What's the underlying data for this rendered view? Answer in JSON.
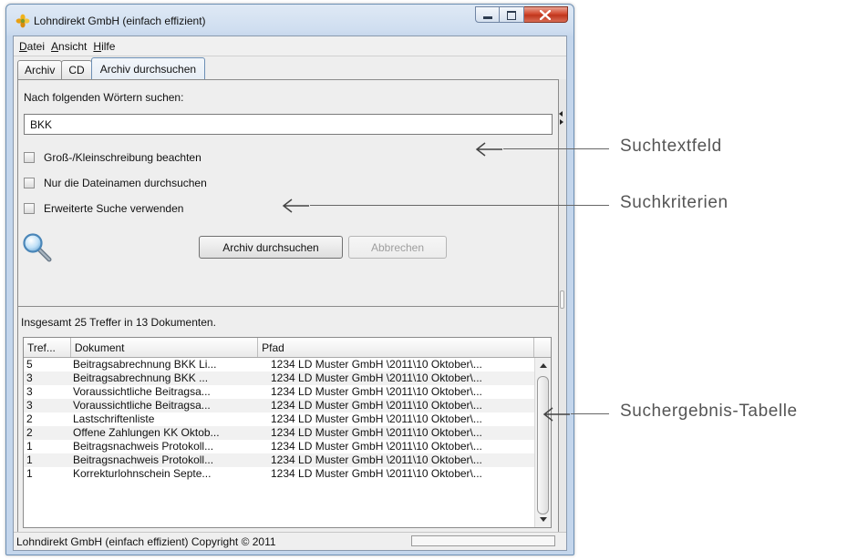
{
  "window": {
    "title": "Lohndirekt GmbH (einfach effizient)"
  },
  "menu": [
    {
      "mnemonic": "D",
      "rest": "atei"
    },
    {
      "mnemonic": "A",
      "rest": "nsicht"
    },
    {
      "mnemonic": "H",
      "rest": "ilfe"
    }
  ],
  "tabs": [
    {
      "label": "Archiv",
      "active": false
    },
    {
      "label": "CD",
      "active": false
    },
    {
      "label": "Archiv durchsuchen",
      "active": true
    }
  ],
  "search": {
    "label": "Nach folgenden Wörtern suchen:",
    "value": "BKK",
    "options": [
      {
        "label": "Groß-/Kleinschreibung beachten",
        "checked": false
      },
      {
        "label": "Nur die Dateinamen durchsuchen",
        "checked": false
      },
      {
        "label": "Erweiterte Suche verwenden",
        "checked": false
      }
    ],
    "search_button": "Archiv durchsuchen",
    "cancel_button": "Abbrechen"
  },
  "results": {
    "summary": "Insgesamt 25 Treffer in 13 Dokumenten.",
    "columns": [
      "Tref...",
      "Dokument",
      "Pfad"
    ],
    "rows": [
      {
        "hits": "5",
        "document": "Beitragsabrechnung BKK Li...",
        "path": "1234 LD Muster GmbH \\2011\\10 Oktober\\..."
      },
      {
        "hits": "3",
        "document": "Beitragsabrechnung BKK ...",
        "path": "1234 LD Muster GmbH \\2011\\10 Oktober\\..."
      },
      {
        "hits": "3",
        "document": "Voraussichtliche Beitragsa...",
        "path": "1234 LD Muster GmbH \\2011\\10 Oktober\\..."
      },
      {
        "hits": "3",
        "document": "Voraussichtliche Beitragsa...",
        "path": "1234 LD Muster GmbH \\2011\\10 Oktober\\..."
      },
      {
        "hits": "2",
        "document": "Lastschriftenliste",
        "path": "1234 LD Muster GmbH \\2011\\10 Oktober\\..."
      },
      {
        "hits": "2",
        "document": "Offene Zahlungen KK Oktob...",
        "path": "1234 LD Muster GmbH \\2011\\10 Oktober\\..."
      },
      {
        "hits": "1",
        "document": "Beitragsnachweis Protokoll...",
        "path": "1234 LD Muster GmbH \\2011\\10 Oktober\\..."
      },
      {
        "hits": "1",
        "document": "Beitragsnachweis Protokoll...",
        "path": "1234 LD Muster GmbH \\2011\\10 Oktober\\..."
      },
      {
        "hits": "1",
        "document": "Korrekturlohnschein Septe...",
        "path": "1234 LD Muster GmbH \\2011\\10 Oktober\\..."
      }
    ]
  },
  "status": {
    "text": "Lohndirekt GmbH (einfach effizient) Copyright © 2011"
  },
  "callouts": {
    "search_field": "Suchtextfeld",
    "criteria": "Suchkriterien",
    "results_table": "Suchergebnis-Tabelle"
  },
  "icons": {
    "app": "flower-icon",
    "search": "magnifier-icon"
  },
  "colors": {
    "title_bar": "#cfdef0",
    "close_button": "#c9452c",
    "callout_text": "#555555"
  }
}
